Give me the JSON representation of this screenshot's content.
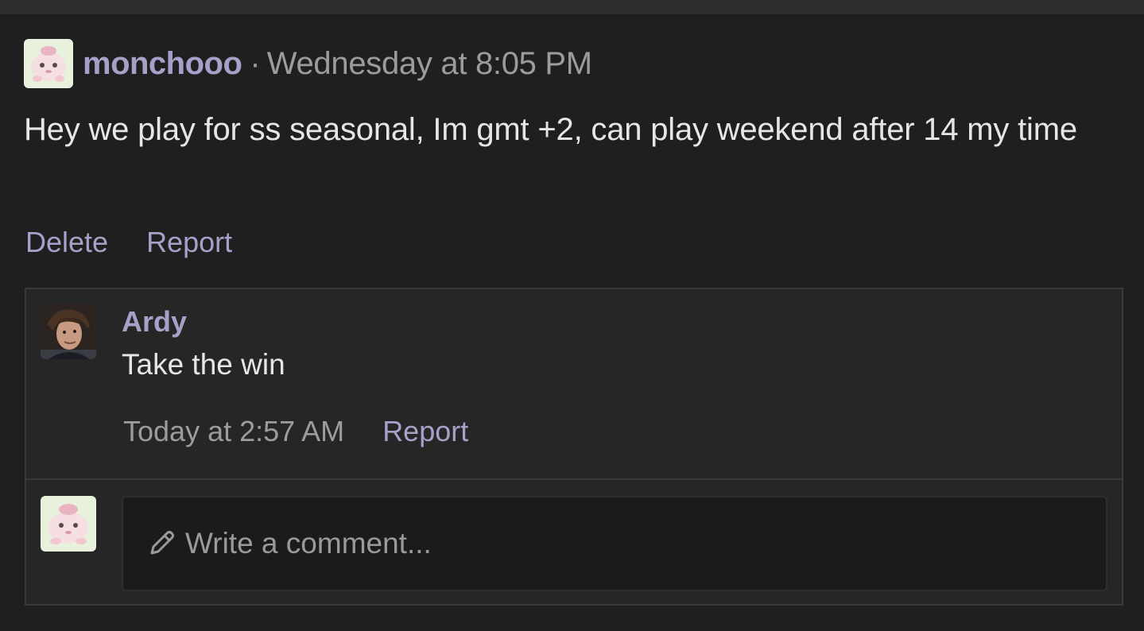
{
  "post": {
    "author": "monchooo",
    "separator": "·",
    "timestamp": "Wednesday at 8:05 PM",
    "body": "Hey we play for ss seasonal, Im gmt +2, can play weekend after 14 my time",
    "actions": {
      "delete_label": "Delete",
      "report_label": "Report"
    }
  },
  "comment": {
    "author": "Ardy",
    "text": "Take the win",
    "timestamp": "Today at 2:57 AM",
    "report_label": "Report"
  },
  "reply": {
    "placeholder": "Write a comment...",
    "icon": "pencil-icon"
  },
  "colors": {
    "background": "#1f1f1f",
    "panel": "#262626",
    "accent": "#a7a0c9",
    "text": "#e6e6e6",
    "muted": "#9c9c9c"
  }
}
